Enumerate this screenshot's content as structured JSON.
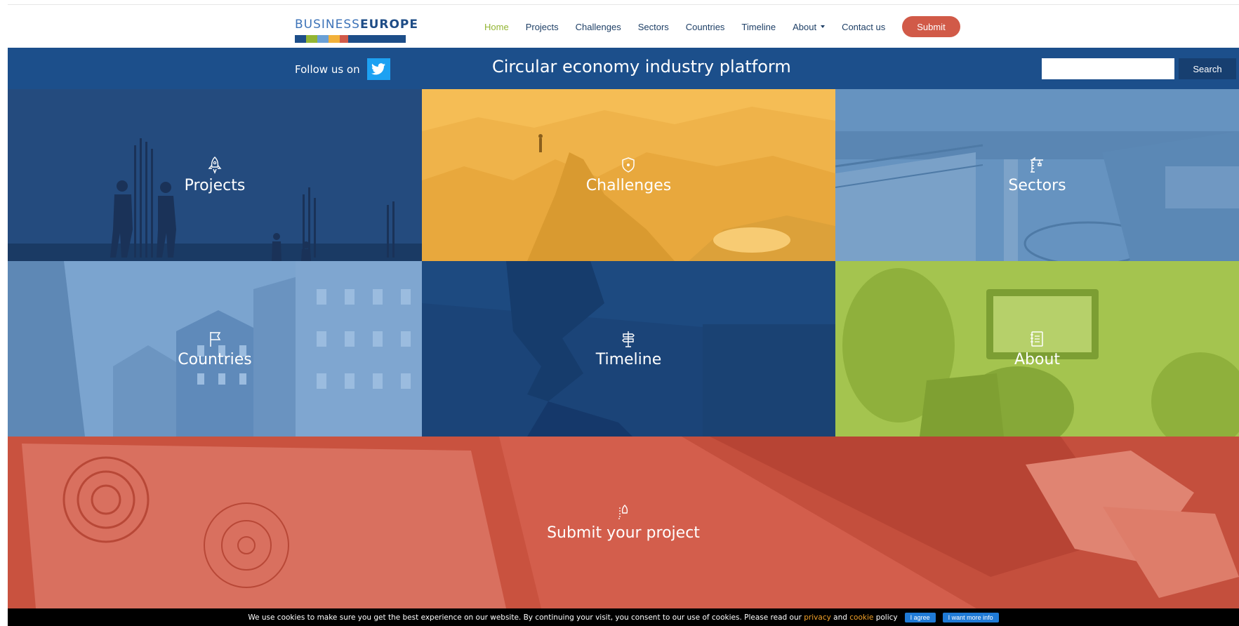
{
  "header": {
    "logo": {
      "part1": "BUSINESS",
      "part2": "EUROPE",
      "bar_colors": [
        "#1d4e89",
        "#93b533",
        "#6aa0d6",
        "#f2b13a",
        "#d15a48",
        "#1d4e89"
      ]
    },
    "nav": [
      {
        "label": "Home",
        "active": true
      },
      {
        "label": "Projects"
      },
      {
        "label": "Challenges"
      },
      {
        "label": "Sectors"
      },
      {
        "label": "Countries"
      },
      {
        "label": "Timeline"
      },
      {
        "label": "About",
        "dropdown": true
      },
      {
        "label": "Contact us"
      }
    ],
    "submit_label": "Submit"
  },
  "bar": {
    "follow_text": "Follow us on",
    "title": "Circular economy industry platform",
    "search_placeholder": "",
    "search_button": "Search"
  },
  "tiles": [
    {
      "label": "Projects",
      "icon": "rocket-icon",
      "color": "#244b7e"
    },
    {
      "label": "Challenges",
      "icon": "shield-icon",
      "color": "#f2b13a"
    },
    {
      "label": "Sectors",
      "icon": "crane-icon",
      "color": "#5f8fbf"
    },
    {
      "label": "Countries",
      "icon": "flag-icon",
      "color": "#6a97c7"
    },
    {
      "label": "Timeline",
      "icon": "signpost-icon",
      "color": "#1d4a80"
    },
    {
      "label": "About",
      "icon": "notebook-icon",
      "color": "#9cbf45"
    },
    {
      "label": "Submit your project",
      "icon": "launch-icon",
      "color": "#d15a48"
    }
  ],
  "cookie": {
    "text1": "We use cookies to make sure you get the best experience on our website. By continuing your visit, you consent to our use of cookies. Please read our",
    "privacy": "privacy",
    "and": "and",
    "cookie_link": "cookie",
    "text2": "policy",
    "agree": "I agree",
    "more": "I want more info"
  },
  "colors": {
    "brand_blue": "#1c4f8b",
    "accent_green": "#93b533",
    "accent_red": "#d15a48",
    "accent_yellow": "#f2b13a"
  }
}
